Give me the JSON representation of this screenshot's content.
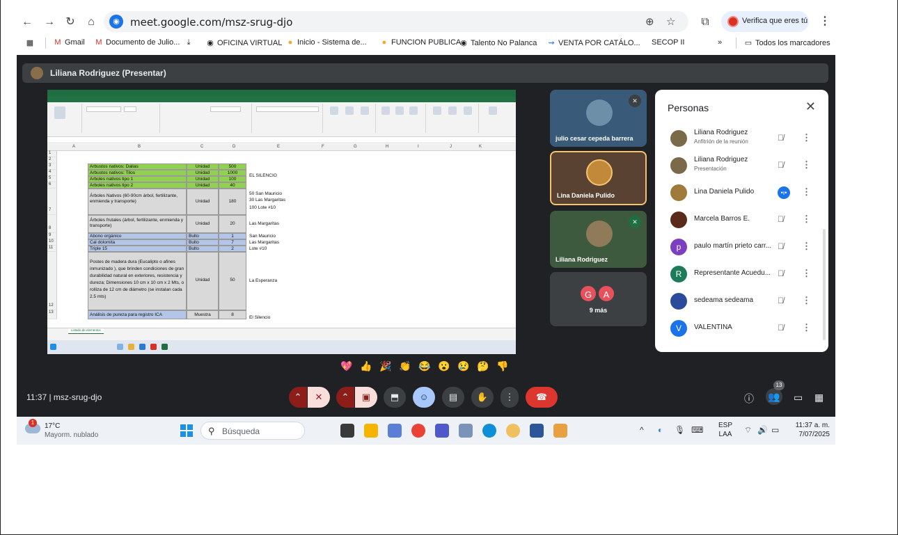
{
  "browser": {
    "url": "meet.google.com/msz-srug-djo",
    "verify_label": "Verifica que eres tú",
    "bookmarks": [
      "Gmail",
      "Documento de Julio...",
      "OFICINA VIRTUAL",
      "Inicio - Sistema de...",
      "FUNCION PUBLICA",
      "Talento No Palanca",
      "VENTA POR CATÁLO...",
      "SECOP II"
    ],
    "more_bookmarks": "»",
    "all_bookmarks": "Todos los marcadores"
  },
  "meet": {
    "presenter": "Liliana Rodriguez (Presentar)",
    "meeting_code": "11:37 | msz-srug-djo",
    "participant_count": "13",
    "tiles": [
      {
        "name": "julio cesar cepeda barrera"
      },
      {
        "name": "Lina Daniela Pulido"
      },
      {
        "name": "Liliana Rodriguez"
      },
      {
        "name": "9 más",
        "avatars": [
          "G",
          "A"
        ]
      }
    ],
    "people_panel": {
      "title": "Personas",
      "people": [
        {
          "name": "Liliana Rodriguez",
          "sub": "Anfitrión de la reunión"
        },
        {
          "name": "Liliana Rodriguez",
          "sub": "Presentación"
        },
        {
          "name": "Lina Daniela Pulido",
          "sub": ""
        },
        {
          "name": "Marcela Barros E.",
          "sub": ""
        },
        {
          "name": "paulo martín prieto carr...",
          "sub": "",
          "initial": "p"
        },
        {
          "name": "Representante Acuedu...",
          "sub": "",
          "initial": "R"
        },
        {
          "name": "sedeama sedeama",
          "sub": ""
        },
        {
          "name": "VALENTINA",
          "sub": "",
          "initial": "V"
        }
      ]
    },
    "colors": {
      "accent": "#1a73e8",
      "end_call": "#dc362e",
      "meet_bg": "#202124"
    }
  },
  "sheet": {
    "columns": [
      "A",
      "B",
      "C",
      "D",
      "E",
      "F",
      "G",
      "H",
      "I",
      "J",
      "K"
    ],
    "rows": [
      {
        "n": "3",
        "b": "Arbustos nativos: Dalias",
        "c": "Unidad",
        "d": "500"
      },
      {
        "n": "4",
        "b": "Arbustos nativos: Tilos",
        "c": "Unidad",
        "d": "1000"
      },
      {
        "n": "5",
        "b": "Árboles nativos tipo 1",
        "c": "Unidad",
        "d": "100"
      },
      {
        "n": "6",
        "b": "Árboles nativos tipo 2",
        "c": "Unidad",
        "d": "40"
      },
      {
        "n": "7",
        "b": "Árboles Nativos (60-90cm árbol, fertilizante, enmienda y transporte)",
        "c": "Unidad",
        "d": "180"
      },
      {
        "n": "8",
        "b": "Árboles frutales (árbol, fertilizante, enmienda y transporte)",
        "c": "Unidad",
        "d": "20"
      },
      {
        "n": "9",
        "b": "Abono orgánico",
        "c": "Bulto",
        "d": "1"
      },
      {
        "n": "10",
        "b": "Cal dolomita",
        "c": "Bulto",
        "d": "7"
      },
      {
        "n": "11",
        "b": "Triple 15",
        "c": "Bulto",
        "d": "2"
      },
      {
        "n": "12",
        "b": "Postes de madera dura (Eucalipto o afines inmunizado ), que brinden condiciones de gran durabilidad natural en exteriores, resistencia y dureza; Dimensiones 10 cm x 10 cm x 2 Mts, o rolliza de 12 cm de diámetro (se instalan cada 2.5 mts)",
        "c": "Unidad",
        "d": "50"
      },
      {
        "n": "13",
        "b": "Análisis de pureza para registro ICA",
        "c": "Muestra",
        "d": "8"
      }
    ],
    "col_e": {
      "el_silencio": "EL SILENCIO",
      "row7": [
        "50 San Mauricio",
        "30 Las Margaritas",
        "100 Lote #10"
      ],
      "row8": "Las Margaritas",
      "row9": "San Mauricio",
      "row10": "Las Margaritas",
      "row11": "Lote #10",
      "row12": "La Esperanza",
      "row13": "El Silencio"
    },
    "sheet_tab": "Listado de elementos"
  },
  "taskbar": {
    "temp": "17°C",
    "weather": "Mayorm. nublado",
    "weather_badge": "1",
    "search_placeholder": "Búsqueda",
    "lang1": "ESP",
    "lang2": "LAA",
    "time": "11:37 a. m.",
    "date": "7/07/2025"
  }
}
